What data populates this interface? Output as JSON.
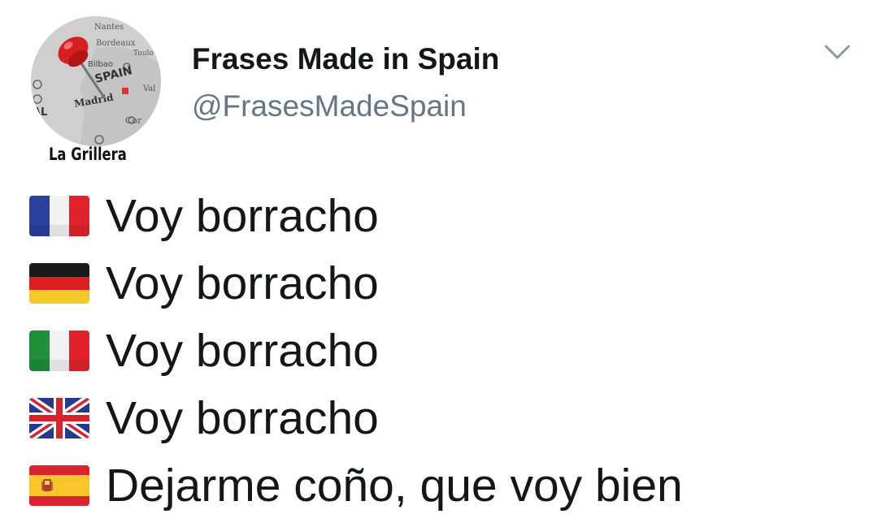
{
  "tweet": {
    "display_name": "Frases Made in Spain",
    "handle": "@FrasesMadeSpain",
    "watermark": "La Grillera",
    "avatar_map_labels": {
      "nantes": "Nantes",
      "bordeaux": "Bordeaux",
      "toulouse": "Toulo",
      "bilbao": "Bilbao",
      "spain": "SPAIN",
      "madrid": "Madrid",
      "val": "Val",
      "cor": "Cor",
      "al": "AL"
    },
    "menu_icon": "chevron-down-icon",
    "lines": [
      {
        "flag": "france-flag-icon",
        "text": "Voy borracho"
      },
      {
        "flag": "germany-flag-icon",
        "text": "Voy borracho"
      },
      {
        "flag": "italy-flag-icon",
        "text": "Voy borracho"
      },
      {
        "flag": "uk-flag-icon",
        "text": "Voy borracho"
      },
      {
        "flag": "spain-flag-icon",
        "text": "Dejarme coño, que voy bien"
      }
    ]
  },
  "colors": {
    "name_text": "#14171a",
    "handle_text": "#657786",
    "caret": "#8899a6",
    "background": "#ffffff"
  }
}
